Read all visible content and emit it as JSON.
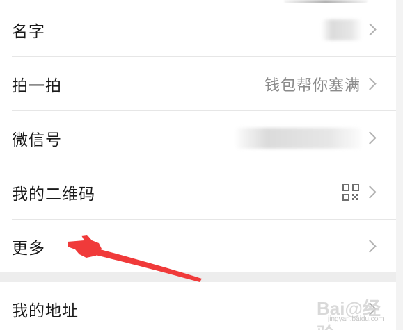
{
  "settings_list": {
    "items": [
      {
        "label": "名字",
        "value": ""
      },
      {
        "label": "拍一拍",
        "value": "钱包帮你塞满"
      },
      {
        "label": "微信号",
        "value": ""
      },
      {
        "label": "我的二维码",
        "value": "",
        "icon": "qr-code-icon"
      },
      {
        "label": "更多",
        "value": ""
      },
      {
        "label": "我的地址",
        "value": ""
      }
    ]
  },
  "annotation": {
    "color": "#f03a3a",
    "icon": "pointing-hand-icon"
  },
  "watermark": {
    "logo_text": "Bai@经验",
    "url": "jingyan.baidu.com"
  },
  "colors": {
    "background": "#ffffff",
    "group_gap": "#ededed",
    "label_text": "#1a1a1a",
    "value_text": "#8a8a8a",
    "chevron": "#b2b2b2",
    "divider": "#e6e6e6"
  }
}
